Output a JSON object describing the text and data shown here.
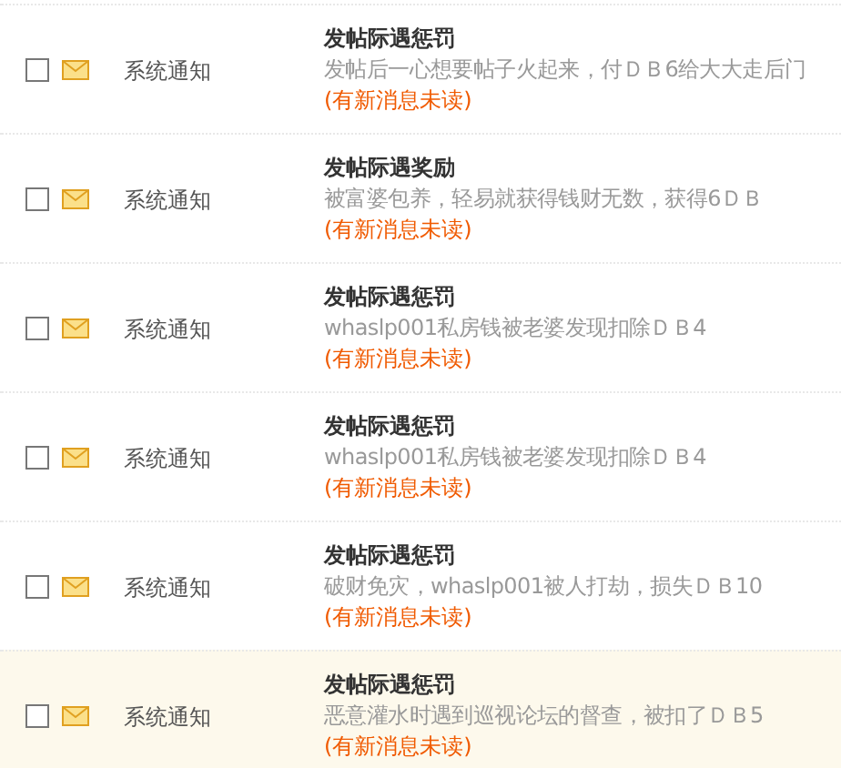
{
  "messages": [
    {
      "checked": false,
      "highlighted": false,
      "sender": "系统通知",
      "title": "发帖际遇惩罚",
      "body": "发帖后一心想要帖子火起来，付ＤＢ6给大大走后门",
      "status": "(有新消息未读)"
    },
    {
      "checked": false,
      "highlighted": false,
      "sender": "系统通知",
      "title": "发帖际遇奖励",
      "body": "被富婆包养，轻易就获得钱财无数，获得6ＤＢ",
      "status": "(有新消息未读)"
    },
    {
      "checked": false,
      "highlighted": false,
      "sender": "系统通知",
      "title": "发帖际遇惩罚",
      "body": "whaslp001私房钱被老婆发现扣除ＤＢ4",
      "status": "(有新消息未读)"
    },
    {
      "checked": false,
      "highlighted": false,
      "sender": "系统通知",
      "title": "发帖际遇惩罚",
      "body": "whaslp001私房钱被老婆发现扣除ＤＢ4",
      "status": "(有新消息未读)"
    },
    {
      "checked": false,
      "highlighted": false,
      "sender": "系统通知",
      "title": "发帖际遇惩罚",
      "body": "破财免灾，whaslp001被人打劫，损失ＤＢ10",
      "status": "(有新消息未读)"
    },
    {
      "checked": false,
      "highlighted": true,
      "sender": "系统通知",
      "title": "发帖际遇惩罚",
      "body": "恶意灌水时遇到巡视论坛的督查，被扣了ＤＢ5",
      "status": "(有新消息未读)"
    }
  ]
}
